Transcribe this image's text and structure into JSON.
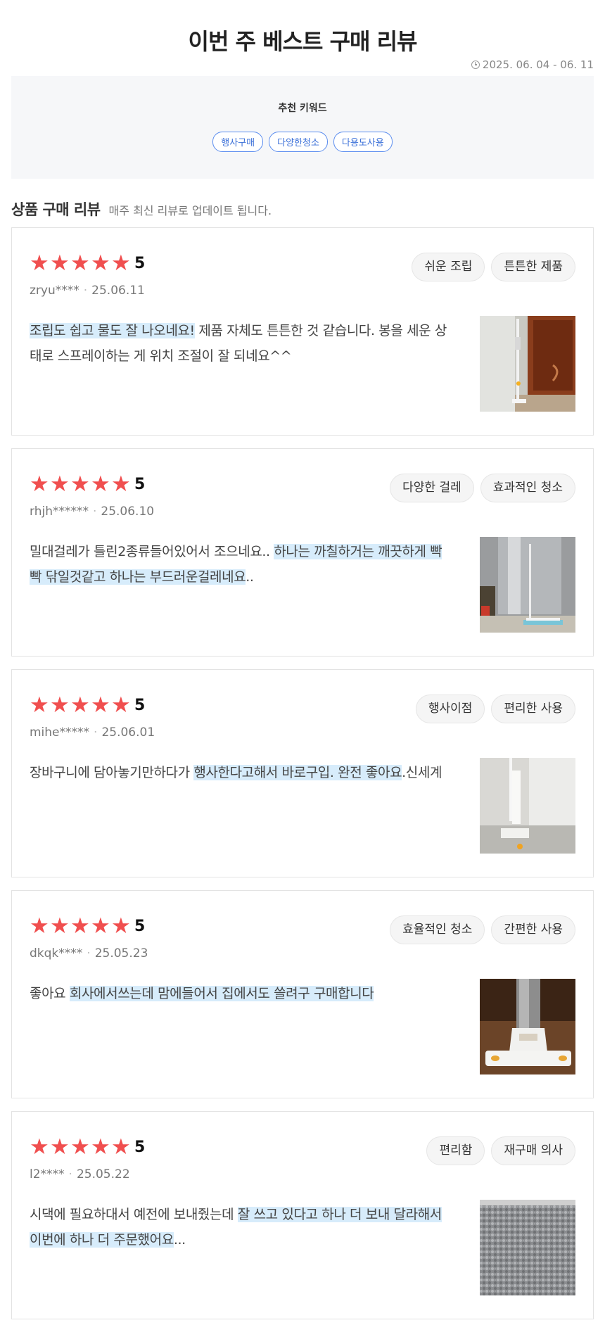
{
  "header": {
    "title": "이번 주 베스트 구매 리뷰",
    "period": "2025. 06. 04 - 06. 11"
  },
  "keywords": {
    "title": "추천 키워드",
    "items": [
      "행사구매",
      "다양한청소",
      "다용도사용"
    ]
  },
  "section": {
    "title": "상품 구매 리뷰",
    "subtitle": "매주 최신 리뷰로 업데이트 됩니다."
  },
  "colors": {
    "star": "#f04f4f",
    "highlight": "#d7ecfb",
    "keyword_border": "#5b8def"
  },
  "reviews": [
    {
      "rating": "5",
      "user": "zryu****",
      "date": "25.06.11",
      "tags": [
        "쉬운 조립",
        "튼튼한 제품"
      ],
      "text_plain_before": "",
      "text_highlight": "조립도 쉽고 물도 잘 나오네요!",
      "text_plain_after": " 제품 자체도 튼튼한 것 같습니다. 봉을 세운 상태로 스프레이하는 게 위치 조절이 잘 되네요^^"
    },
    {
      "rating": "5",
      "user": "rhjh******",
      "date": "25.06.10",
      "tags": [
        "다양한 걸레",
        "효과적인 청소"
      ],
      "text_plain_before": "밀대걸레가 틀린2종류들어있어서 조으네요.. ",
      "text_highlight": "하나는 까칠하거는 깨끗하게 빡빡 닦일것같고 하나는 부드러운걸레네요",
      "text_plain_after": ".."
    },
    {
      "rating": "5",
      "user": "mihe*****",
      "date": "25.06.01",
      "tags": [
        "행사이점",
        "편리한 사용"
      ],
      "text_plain_before": "장바구니에 담아놓기만하다가 ",
      "text_highlight": "행사한다고해서 바로구입. 완전 좋아요",
      "text_plain_after": ".신세계"
    },
    {
      "rating": "5",
      "user": "dkqk****",
      "date": "25.05.23",
      "tags": [
        "효율적인 청소",
        "간편한 사용"
      ],
      "text_plain_before": "좋아요 ",
      "text_highlight": "회사에서쓰는데 맘에들어서 집에서도 쓸려구 구매합니다",
      "text_plain_after": ""
    },
    {
      "rating": "5",
      "user": "l2****",
      "date": "25.05.22",
      "tags": [
        "편리함",
        "재구매 의사"
      ],
      "text_plain_before": "시댁에 필요하대서 예전에 보내줬는데 ",
      "text_highlight": "잘 쓰고 있다고 하나 더 보내 달라해서 이번에 하나 더 주문했어요",
      "text_plain_after": "..."
    }
  ]
}
